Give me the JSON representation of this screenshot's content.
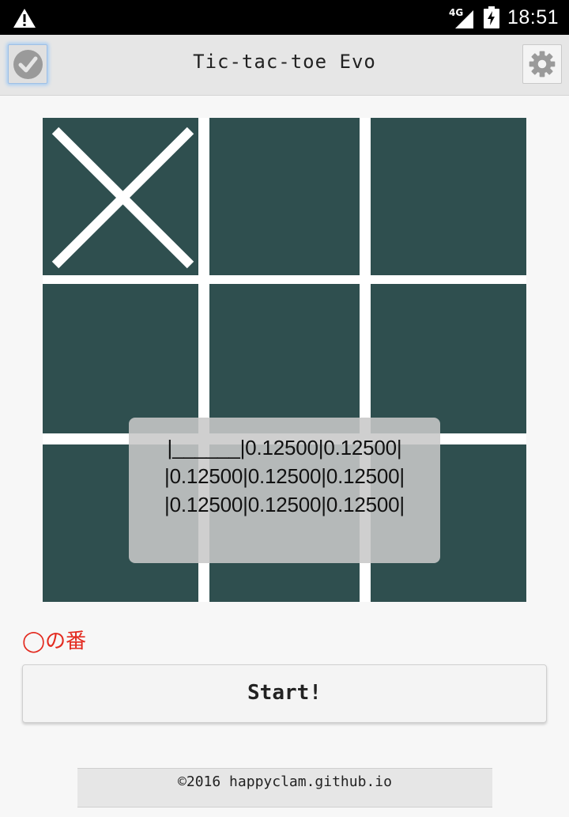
{
  "status_bar": {
    "warning_icon": "warning-icon",
    "network_label": "4G",
    "signal_icon": "cell-signal-icon",
    "battery_icon": "battery-charging-icon",
    "time": "18:51"
  },
  "app_bar": {
    "left_icon": "check-circle-icon",
    "title": "Tic-tac-toe Evo",
    "right_icon": "gear-icon"
  },
  "board": {
    "background_color": "#2f4f4f",
    "grid_color": "#ffffff",
    "cells": [
      "X",
      "",
      "",
      "",
      "",
      "",
      "",
      "",
      ""
    ]
  },
  "probability_toast": {
    "lines": [
      "|______|0.12500|0.12500|",
      "|0.12500|0.12500|0.12500|",
      "|0.12500|0.12500|0.12500|"
    ]
  },
  "turn_text": "◯の番",
  "turn_color": "#e32a1f",
  "start_button": {
    "label": "Start!"
  },
  "footer": {
    "text": "©2016 happyclam.github.io"
  }
}
